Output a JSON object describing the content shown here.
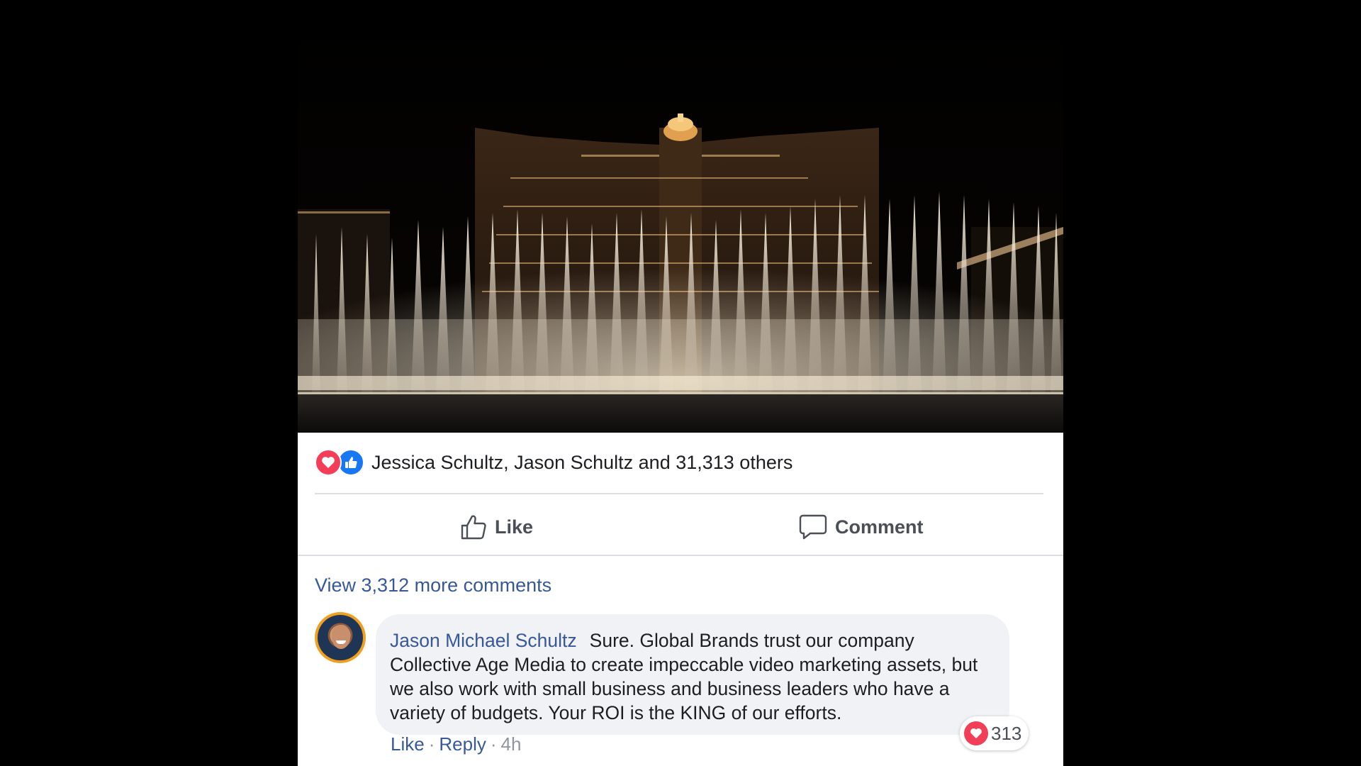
{
  "post": {
    "photo": {
      "subject": "fountain-show-photo"
    },
    "reactions": {
      "icons": [
        "love-icon",
        "like-icon"
      ],
      "summary": "Jessica Schultz, Jason Schultz and 31,313 others",
      "colors": {
        "love": "#f33e58",
        "like": "#1877f2"
      }
    },
    "actions": {
      "like_label": "Like",
      "comment_label": "Comment"
    },
    "view_more_comments": "View 3,312 more comments",
    "comment": {
      "author": "Jason Michael Schultz",
      "text": "Sure. Global Brands trust our company Collective Age Media to create impeccable video marketing assets, but we also work with small business and business leaders who have a variety of budgets. Your ROI is the KING of our efforts.",
      "love_count": "313",
      "like_label": "Like",
      "reply_label": "Reply",
      "time": "4h"
    }
  }
}
